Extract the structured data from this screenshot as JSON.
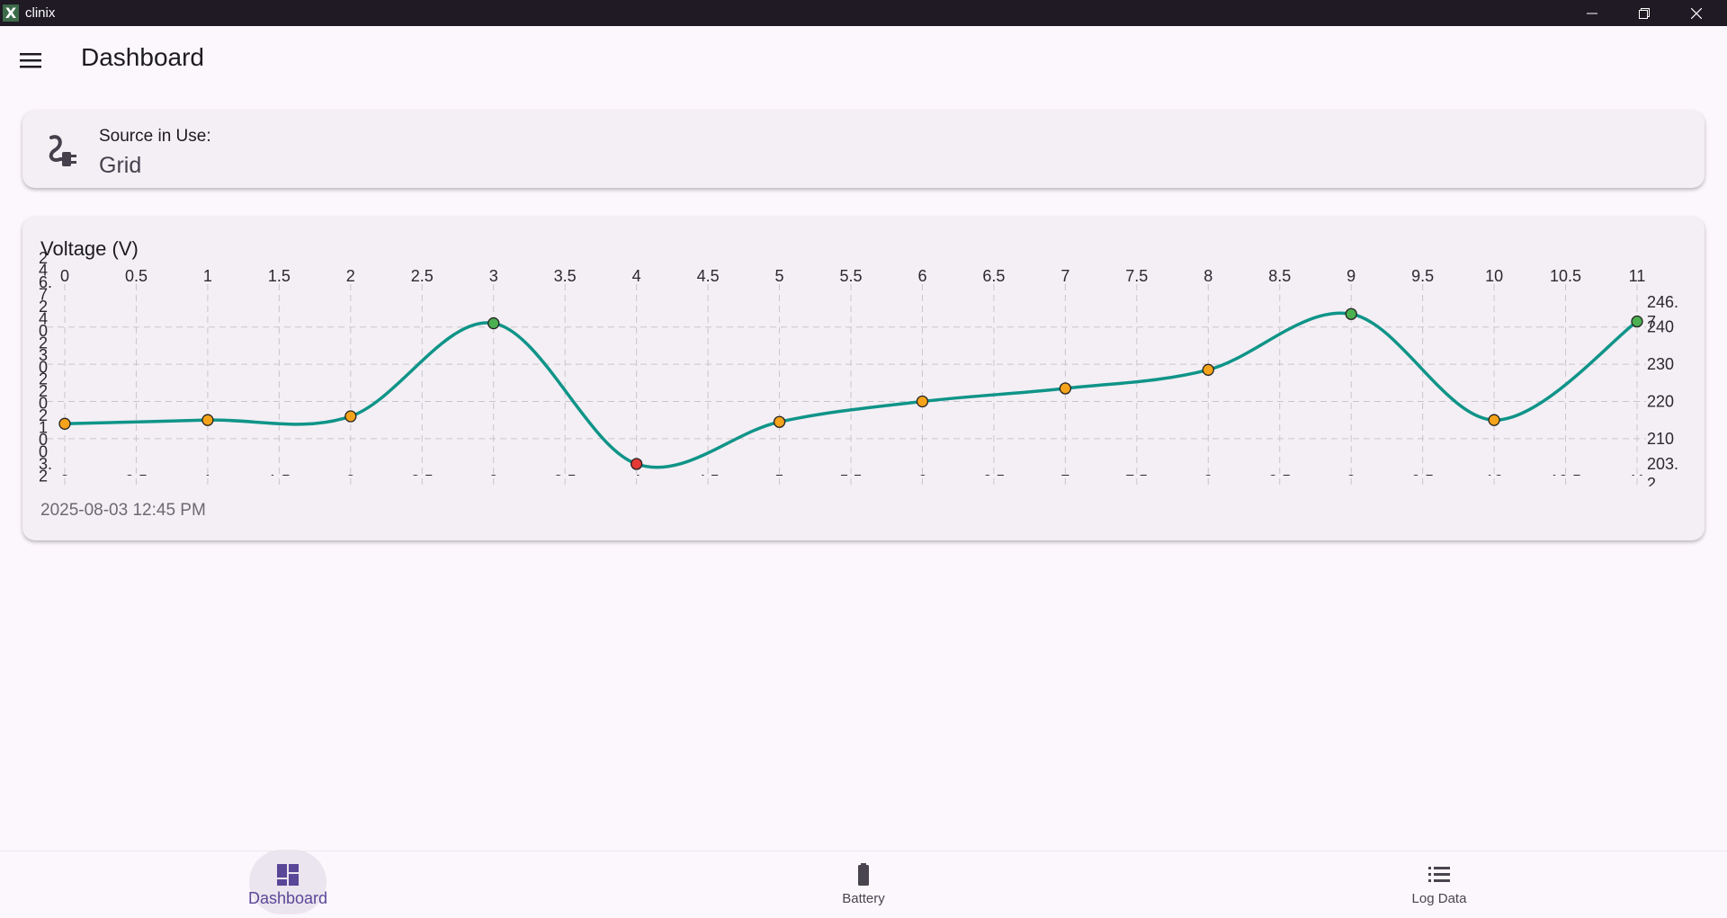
{
  "window": {
    "title": "clinix",
    "app_icon": "X"
  },
  "header": {
    "title": "Dashboard",
    "menu_icon": "hamburger-icon"
  },
  "source_card": {
    "label": "Source in Use:",
    "value": "Grid",
    "icon": "power-plug-icon"
  },
  "chart_card": {
    "title": "Voltage (V)",
    "timestamp": "2025-08-03 12:45 PM"
  },
  "chart_data": {
    "type": "line",
    "title": "Voltage (V)",
    "x": [
      0,
      1,
      2,
      3,
      4,
      5,
      6,
      7,
      8,
      9,
      10,
      11
    ],
    "series": [
      {
        "values": [
          214,
          215,
          216,
          241,
          203.2,
          214.5,
          220,
          223.5,
          228.5,
          243.5,
          215,
          241.5
        ],
        "point_colors": [
          "#f5a31a",
          "#f5a31a",
          "#f5a31a",
          "#4caf50",
          "#e53935",
          "#f5a31a",
          "#f5a31a",
          "#f5a31a",
          "#f5a31a",
          "#4caf50",
          "#f5a31a",
          "#4caf50"
        ]
      }
    ],
    "xlim": [
      0,
      11
    ],
    "ylim": [
      203.2,
      246.7
    ],
    "x_ticks": [
      "0",
      "0.5",
      "1",
      "1.5",
      "2",
      "2.5",
      "3",
      "3.5",
      "4",
      "4.5",
      "5",
      "5.5",
      "6",
      "6.5",
      "7",
      "7.5",
      "8",
      "8.5",
      "9",
      "9.5",
      "10",
      "10.5",
      "11"
    ],
    "y_ticks_right": [
      {
        "value": 246.7,
        "lines": [
          "246.",
          "7"
        ]
      },
      {
        "value": 240,
        "lines": [
          "240"
        ]
      },
      {
        "value": 230,
        "lines": [
          "230"
        ]
      },
      {
        "value": 220,
        "lines": [
          "220"
        ]
      },
      {
        "value": 210,
        "lines": [
          "210"
        ]
      },
      {
        "value": 203.2,
        "lines": [
          "203.",
          "2"
        ]
      }
    ],
    "y_ticks_left_chars": [
      "2",
      "4",
      "6.",
      "7",
      "2",
      "4",
      "0",
      "2",
      "3",
      "0",
      "2",
      "2",
      "0",
      "2",
      "1",
      "0",
      "0",
      "3.",
      "2"
    ],
    "grid": true,
    "line_color": "#0f9488"
  },
  "nav": {
    "items": [
      {
        "label": "Dashboard",
        "icon": "dashboard-icon",
        "active": true
      },
      {
        "label": "Battery",
        "icon": "battery-icon",
        "active": false
      },
      {
        "label": "Log Data",
        "icon": "list-icon",
        "active": false
      }
    ]
  }
}
